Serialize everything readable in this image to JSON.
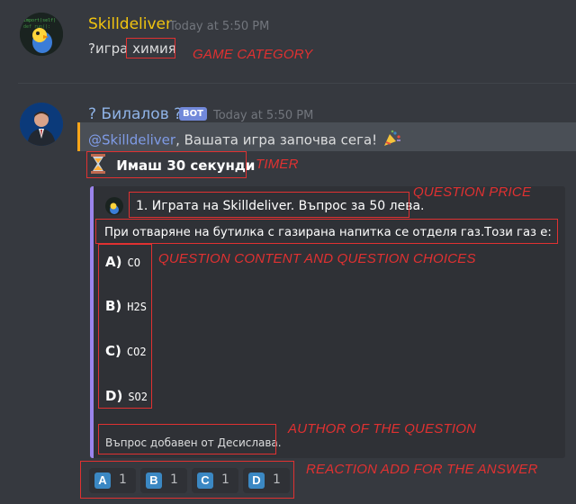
{
  "message1": {
    "author": "Skilldeliver",
    "timestamp": "Today at 5:50 PM",
    "text_prefix": "?игра ",
    "text_category": "химия"
  },
  "message2": {
    "author": "? Билалов ?",
    "bot_tag": "BOT",
    "timestamp": "Today at 5:50 PM",
    "mention": "@Skilldeliver",
    "mention_text": ", Вашата игра започва сега!",
    "timer_text": "Имаш 30 секунди"
  },
  "embed": {
    "title": "1. Играта на Skilldeliver. Въпрос за 50 лева.",
    "question": "При отваряне на бутилка с газирана напитка се отделя газ.Този газ е:",
    "choices": [
      {
        "letter": "A)",
        "value": "CO"
      },
      {
        "letter": "B)",
        "value": "H2S"
      },
      {
        "letter": "C)",
        "value": "CO2"
      },
      {
        "letter": "D)",
        "value": "SO2"
      }
    ],
    "footer": "Въпрос добавен от Десислава."
  },
  "reactions": [
    {
      "emoji": "A",
      "count": "1"
    },
    {
      "emoji": "B",
      "count": "1"
    },
    {
      "emoji": "C",
      "count": "1"
    },
    {
      "emoji": "D",
      "count": "1"
    }
  ],
  "annotations": {
    "game_category": "GAME CATEGORY",
    "timer": "TIMER",
    "question_price": "QUESTION PRICE",
    "question_content": "QUESTION CONTENT AND QUESTION CHOICES",
    "author": "AUTHOR OF THE QUESTION",
    "reaction": "REACTION ADD FOR THE ANSWER"
  },
  "colors": {
    "background": "#36393f",
    "author1": "#f1c40f",
    "author2": "#8fb3e6",
    "mention": "#7289da",
    "embed_border": "#9b84ec",
    "annotation": "#e03131"
  }
}
